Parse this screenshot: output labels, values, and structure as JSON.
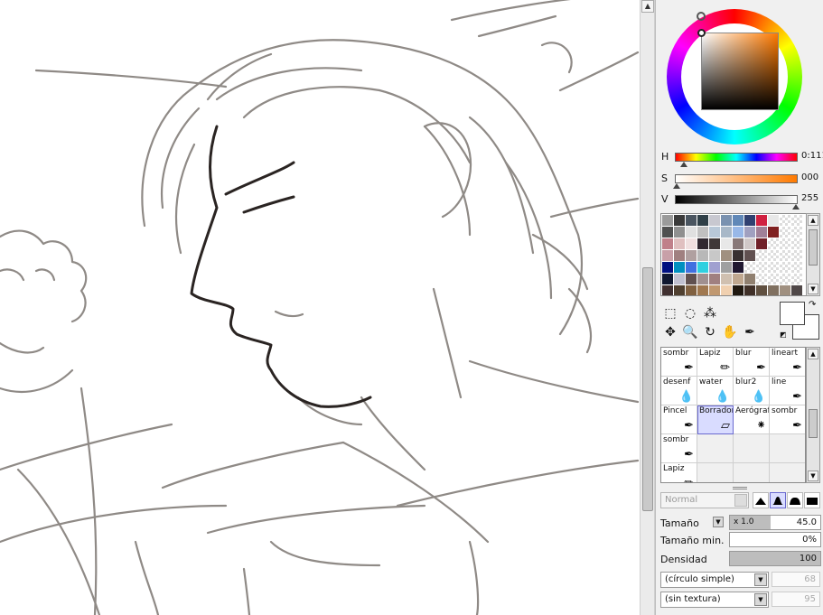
{
  "canvas": {
    "description_icon": "line-art-sketch"
  },
  "color": {
    "hue_value": "0:111",
    "sat_value": "000",
    "val_value": "255",
    "h_label": "H",
    "s_label": "S",
    "v_label": "V",
    "accent": "#ff7a00"
  },
  "palette": {
    "swatches": [
      "#9a9a9a",
      "#3a3a3a",
      "#4a5560",
      "#304048",
      "#c8c8d0",
      "#7a92b0",
      "#6088b8",
      "#304070",
      "#d02040",
      "#e8e8e8",
      "#ffffff",
      "#ffffff",
      "#505050",
      "#909090",
      "#e0e0e0",
      "#c0c0c0",
      "#b8c8d8",
      "#a8b8c8",
      "#98b8e8",
      "#a0a0c0",
      "#a08098",
      "#802020",
      "#ffffff",
      "#ffffff",
      "#c0808a",
      "#e0c0c0",
      "#f0e0e0",
      "#302830",
      "#403838",
      "#e8e8e8",
      "#887878",
      "#d0c8c8",
      "#702028",
      "#ffffff",
      "#ffffff",
      "#ffffff",
      "#c8a0a8",
      "#a08080",
      "#b0a0a0",
      "#b8b8b8",
      "#c8c8c8",
      "#a09080",
      "#383030",
      "#605050",
      "#ffffff",
      "#ffffff",
      "#ffffff",
      "#ffffff",
      "#001080",
      "#0090c0",
      "#4070e0",
      "#30d0e0",
      "#a0a0d0",
      "#a0a0a0",
      "#201830",
      "#ffffff",
      "#ffffff",
      "#ffffff",
      "#ffffff",
      "#ffffff",
      "#101830",
      "#c0c0d0",
      "#605050",
      "#a09090",
      "#a08080",
      "#d0c0b0",
      "#c0a890",
      "#908070",
      "#ffffff",
      "#ffffff",
      "#ffffff",
      "#ffffff",
      "#403030",
      "#504030",
      "#806040",
      "#a07850",
      "#c09870",
      "#f0d0b0",
      "#201810",
      "#403028",
      "#605040",
      "#807060",
      "#a09080",
      "#504848"
    ]
  },
  "tools": [
    {
      "name": "select-rect-icon",
      "glyph": "⬚"
    },
    {
      "name": "lasso-icon",
      "glyph": "◌"
    },
    {
      "name": "magic-wand-icon",
      "glyph": "⁂"
    },
    {
      "name": "move-icon",
      "glyph": "✥"
    },
    {
      "name": "zoom-icon",
      "glyph": "🔍"
    },
    {
      "name": "rotate-icon",
      "glyph": "↻"
    },
    {
      "name": "hand-icon",
      "glyph": "✋"
    },
    {
      "name": "eyedropper-icon",
      "glyph": "✒"
    }
  ],
  "brushes": [
    {
      "label": "sombr",
      "icon": "✒",
      "selected": false
    },
    {
      "label": "Lapiz",
      "icon": "✏",
      "selected": false
    },
    {
      "label": "blur",
      "icon": "✒",
      "selected": false
    },
    {
      "label": "lineart",
      "icon": "✒",
      "selected": false
    },
    {
      "label": "desenf",
      "icon": "💧",
      "selected": false
    },
    {
      "label": "water",
      "icon": "💧",
      "selected": false
    },
    {
      "label": "blur2",
      "icon": "💧",
      "selected": false
    },
    {
      "label": "line",
      "icon": "✒",
      "selected": false
    },
    {
      "label": "Pincel",
      "icon": "✒",
      "selected": false
    },
    {
      "label": "Borrador",
      "icon": "▱",
      "selected": true
    },
    {
      "label": "Aerógrafo",
      "icon": "⁕",
      "selected": false
    },
    {
      "label": "sombr",
      "icon": "✒",
      "selected": false
    },
    {
      "label": "sombr",
      "icon": "✒",
      "selected": false
    },
    {
      "label": "",
      "icon": "",
      "selected": false
    },
    {
      "label": "",
      "icon": "",
      "selected": false
    },
    {
      "label": "",
      "icon": "",
      "selected": false
    },
    {
      "label": "Lapiz",
      "icon": "✏",
      "selected": false
    },
    {
      "label": "",
      "icon": "",
      "selected": false
    },
    {
      "label": "",
      "icon": "",
      "selected": false
    },
    {
      "label": "",
      "icon": "",
      "selected": false
    }
  ],
  "blend_mode": "Normal",
  "props": {
    "size_label": "Tamaño",
    "size_mult": "x 1.0",
    "size_value": "45.0",
    "size_fill": 0.45,
    "min_size_label": "Tamaño min.",
    "min_size_value": "0%",
    "density_label": "Densidad",
    "density_value": "100",
    "density_fill": 1.0
  },
  "shape_combo": "(círculo simple)",
  "shape_value": "68",
  "texture_combo": "(sin textura)",
  "texture_value": "95"
}
